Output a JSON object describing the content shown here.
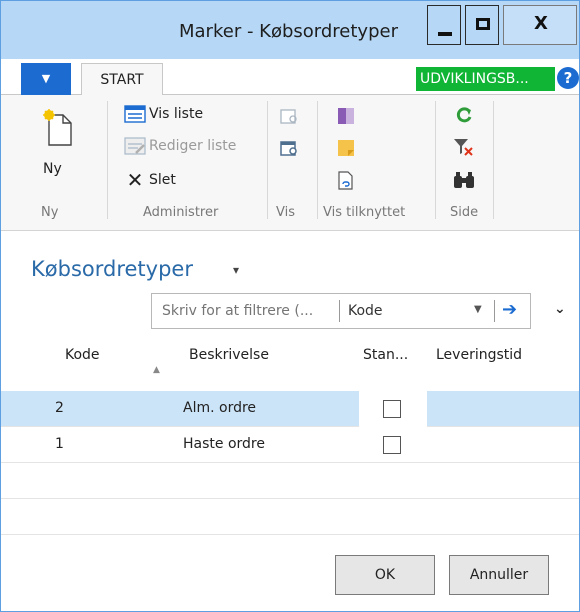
{
  "window": {
    "title": "Marker - Købsordretyper",
    "close_glyph": "X"
  },
  "tabs": {
    "start": "START",
    "environment_badge": "UDVIKLINGSB...",
    "help": "?"
  },
  "ribbon": {
    "new": {
      "label": "Ny",
      "group": "Ny"
    },
    "manage": {
      "group": "Administrer",
      "show_list": "Vis liste",
      "edit_list": "Rediger liste",
      "delete": "Slet"
    },
    "view_group": "Vis",
    "attached_group": "Vis tilknyttet",
    "page_group": "Side"
  },
  "page": {
    "title": "Købsordretyper"
  },
  "filter": {
    "placeholder": "Skriv for at filtrere (...",
    "field": "Kode"
  },
  "grid": {
    "columns": {
      "code": "Kode",
      "description": "Beskrivelse",
      "standard": "Stan...",
      "lead_time": "Leveringstid"
    },
    "rows": [
      {
        "code": "2",
        "description": "Alm. ordre",
        "standard": false,
        "lead_time": ""
      },
      {
        "code": "1",
        "description": "Haste ordre",
        "standard": false,
        "lead_time": ""
      }
    ]
  },
  "buttons": {
    "ok": "OK",
    "cancel": "Annuller"
  },
  "colors": {
    "accent": "#1b6bd0",
    "titlebar": "#b6d8f6",
    "badge": "#10b536",
    "selected_row": "#cce4f7",
    "heading": "#2a6aa8"
  }
}
